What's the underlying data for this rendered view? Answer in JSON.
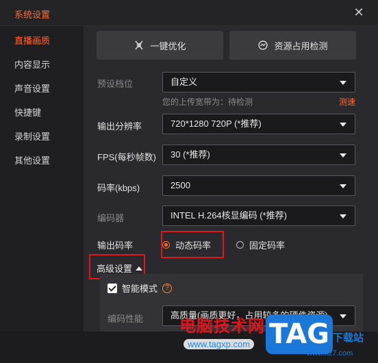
{
  "window": {
    "title": "系统设置",
    "close_glyph": "✕"
  },
  "sidebar": {
    "items": [
      {
        "label": "直播画质",
        "active": true
      },
      {
        "label": "内容显示",
        "active": false
      },
      {
        "label": "声音设置",
        "active": false
      },
      {
        "label": "快捷键",
        "active": false
      },
      {
        "label": "录制设置",
        "active": false
      },
      {
        "label": "其他设置",
        "active": false
      }
    ]
  },
  "actions": {
    "optimize_label": "一键优化",
    "optimize_icon": "wand-icon",
    "resource_label": "资源占用检测",
    "resource_icon": "gauge-icon"
  },
  "form": {
    "preset": {
      "label": "预设档位",
      "value": "自定义"
    },
    "upload_hint": "您的上传宽带为：待检测",
    "speed_test": "测速",
    "resolution": {
      "label": "输出分辨率",
      "value": "720*1280 720P (*推荐)"
    },
    "fps": {
      "label": "FPS(每秒帧数)",
      "value": "30 (*推荐)"
    },
    "bitrate": {
      "label": "码率(kbps)",
      "value": "2500"
    },
    "encoder": {
      "label": "编码器",
      "value": "INTEL H.264核显编码 (*推荐)"
    },
    "output_rate": {
      "label": "输出码率",
      "options": [
        {
          "label": "动态码率",
          "selected": true
        },
        {
          "label": "固定码率",
          "selected": false
        }
      ]
    },
    "advanced": {
      "label": "高级设置",
      "smart_mode": {
        "label": "智能模式",
        "checked": true,
        "help": "?"
      },
      "encode_perf": {
        "label": "编码性能",
        "value": "高质量(画质更好，占用较多的硬件资源)"
      }
    }
  },
  "colors": {
    "accent": "#ff6a2c",
    "highlight_box": "#e3171b"
  },
  "watermark": {
    "text": "电脑技术网",
    "url": "www.tagxp.com",
    "logo": "TAG",
    "site": "下载站",
    "domain": "www.xz7.com"
  }
}
